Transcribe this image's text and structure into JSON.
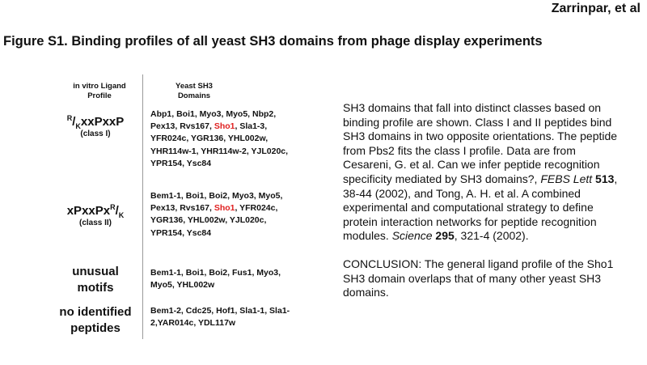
{
  "header": {
    "author": "Zarrinpar, et al"
  },
  "figure": {
    "title": "Figure S1.  Binding profiles of all yeast SH3 domains from phage display experiments"
  },
  "table": {
    "col1_header": [
      "in vitro Ligand",
      "Profile"
    ],
    "col2_header": [
      "Yeast SH3",
      "Domains"
    ],
    "rows": [
      {
        "label": {
          "prefix_sup": "R",
          "slash": "/",
          "prefix_sub": "K",
          "main": "xxPxxP",
          "class": "(class I)"
        },
        "domains_pre": "Abp1, Boi1, Myo3, Myo5, Nbp2, Pex13, Rvs167, ",
        "domains_hl": "Sho1",
        "domains_post": ", Sla1-3, YFR024c, YGR136, YHL002w, YHR114w-1, YHR114w-2, YJL020c, YPR154, Ysc84"
      },
      {
        "label": {
          "main": "xPxxPx",
          "suffix_sup": "R",
          "slash": "/",
          "suffix_sub": "K",
          "class": "(class II)"
        },
        "domains_pre": "Bem1-1, Boi1, Boi2, Myo3, Myo5, Pex13, Rvs167, ",
        "domains_hl": "Sho1",
        "domains_post": ", YFR024c, YGR136, YHL002w, YJL020c, YPR154, Ysc84"
      },
      {
        "label": {
          "line1": "unusual",
          "line2": "motifs"
        },
        "domains": "Bem1-1, Boi1, Boi2, Fus1, Myo3, Myo5, YHL002w"
      },
      {
        "label": {
          "line1": "no identified",
          "line2": "peptides"
        },
        "domains": "Bem1-2, Cdc25, Hof1, Sla1-1, Sla1-2,YAR014c, YDL117w"
      }
    ]
  },
  "description": {
    "p1_a": "SH3 domains that fall into distinct classes based on binding profile are shown.  Class I and II peptides bind SH3 domains in two opposite orientations.  The peptide from Pbs2 fits the class I profile.  Data are from Cesareni, G. et al. Can we infer peptide recognition specificity mediated by SH3 domains?, ",
    "p1_journal1": "FEBS Lett",
    "p1_space1": " ",
    "p1_vol1": "513",
    "p1_b": ", 38-44 (2002), and Tong, A. H. et al. A combined experimental and computational strategy to define protein interaction networks for peptide recognition modules. ",
    "p1_journal2": "Science",
    "p1_space2": " ",
    "p1_vol2": "295",
    "p1_c": ", 321-4 (2002).",
    "p2": "CONCLUSION:  The general ligand profile of the Sho1 SH3 domain overlaps that of many other yeast SH3 domains."
  }
}
